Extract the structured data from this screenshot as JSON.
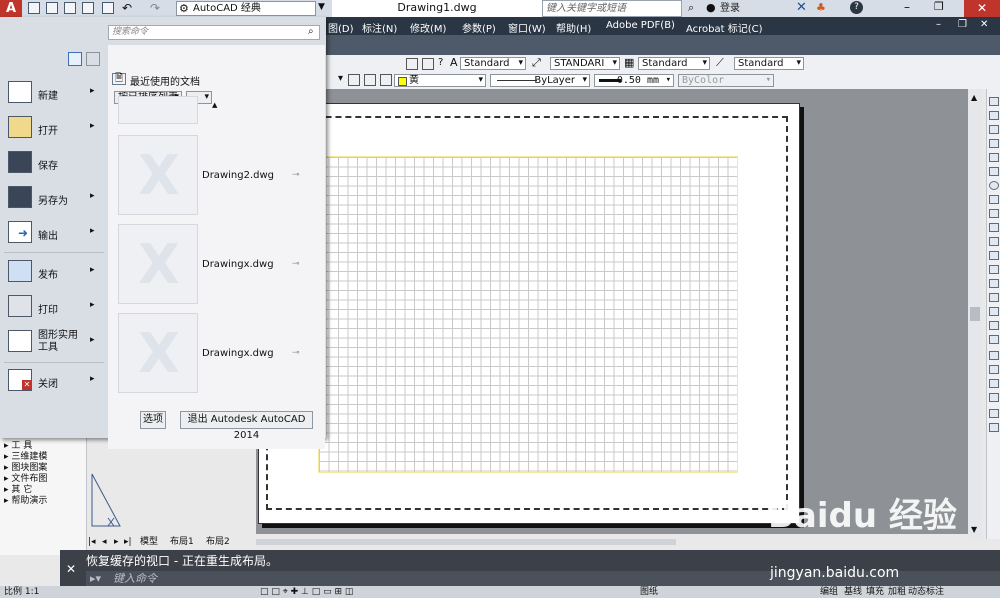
{
  "quick_access": {
    "workspace": "AutoCAD 经典",
    "title": "Drawing1.dwg",
    "search_placeholder": "键入关键字或短语",
    "login_label": "登录"
  },
  "menubar": {
    "items": [
      "图(D)",
      "标注(N)",
      "修改(M)",
      "参数(P)",
      "窗口(W)",
      "帮助(H)",
      "Adobe PDF(B)",
      "Acrobat 标记(C)"
    ]
  },
  "toolbar1": {
    "text_style": "Standard",
    "dim_style": "STANDARI",
    "table_style": "Standard",
    "multileader_style": "Standard"
  },
  "toolbar2": {
    "color": "黄",
    "linetype": "ByLayer",
    "lineweight": "0.50 mm",
    "plotstyle": "ByColor"
  },
  "app_menu": {
    "search_placeholder": "搜索命令",
    "recent_docs_title": "最近使用的文档",
    "sort_label": "按已排序列表",
    "items": [
      {
        "label": "新建",
        "icon": "new-file-icon"
      },
      {
        "label": "打开",
        "icon": "open-folder-icon"
      },
      {
        "label": "保存",
        "icon": "save-icon"
      },
      {
        "label": "另存为",
        "icon": "save-as-icon"
      },
      {
        "label": "输出",
        "icon": "export-icon"
      },
      {
        "label": "发布",
        "icon": "publish-icon"
      },
      {
        "label": "打印",
        "icon": "print-icon"
      },
      {
        "label": "图形实用\n工具",
        "icon": "wrench-icon"
      },
      {
        "label": "关闭",
        "icon": "close-file-icon"
      }
    ],
    "recent_files": [
      {
        "name": "Drawing2.dwg"
      },
      {
        "name": "Drawingx.dwg"
      },
      {
        "name": "Drawingx.dwg"
      }
    ],
    "options_button": "选项",
    "exit_button": "退出 Autodesk AutoCAD 2014"
  },
  "left_panel": {
    "items": [
      "工    具",
      "三维建模",
      "图块图案",
      "文件布图",
      "其    它",
      "帮助演示"
    ]
  },
  "layout_tabs": [
    "模型",
    "布局1",
    "布局2"
  ],
  "command": {
    "history": "恢复缓存的视口 - 正在重生成布局。",
    "input_placeholder": "键入命令"
  },
  "status_bar": {
    "scale": "比例 1:1",
    "items": [
      "图纸",
      "编组",
      "基线",
      "填充",
      "加粗",
      "动态标注"
    ]
  },
  "watermark": {
    "logo": "Baidu 经验",
    "url": "jingyan.baidu.com"
  },
  "colors": {
    "menubar_bg": "#2b3645",
    "accent_red": "#c0352b",
    "grid_border": "#f3ea9b"
  }
}
